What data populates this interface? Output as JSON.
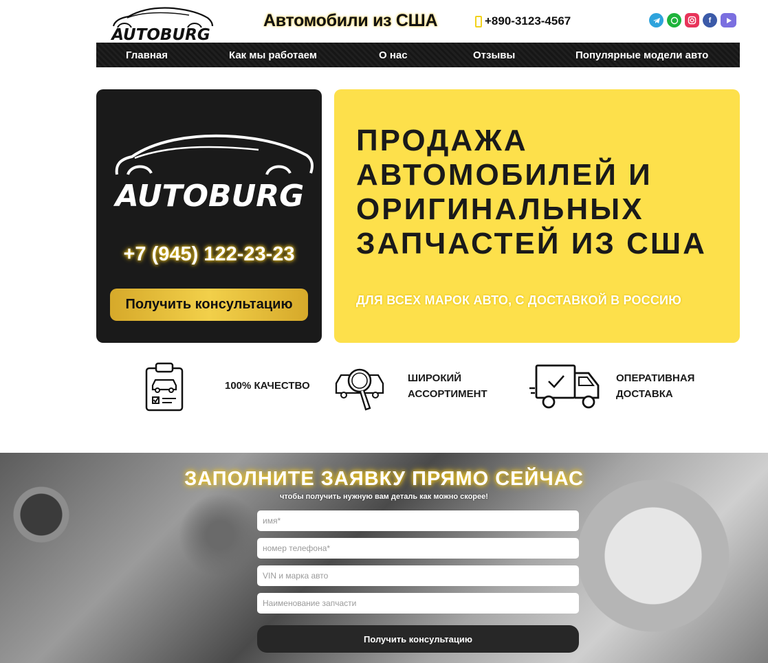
{
  "header": {
    "logo_text": "AUTOBURG",
    "tagline": "Автомобили из США",
    "phone": "+890-3123-4567",
    "socials": [
      "telegram-icon",
      "whatsapp-icon",
      "instagram-icon",
      "facebook-icon",
      "youtube-icon"
    ]
  },
  "nav": {
    "items": [
      "Главная",
      "Как мы работаем",
      "О нас",
      "Отзывы",
      "Популярные модели авто"
    ]
  },
  "hero": {
    "logo_text": "AUTOBURG",
    "phone": "+7 (945) 122-23-23",
    "consult_button": "Получить консультацию",
    "title_lines": [
      "ПРОДАЖА",
      "АВТОМОБИЛЕЙ И",
      "ОРИГИНАЛЬНЫХ",
      "ЗАПЧАСТЕЙ ИЗ США"
    ],
    "subtitle": "ДЛЯ ВСЕХ МАРОК АВТО, С ДОСТАВКОЙ В РОССИЮ"
  },
  "features": [
    {
      "icon": "clipboard-car-icon",
      "lines": [
        "100% КАЧЕСТВО"
      ]
    },
    {
      "icon": "magnifier-car-icon",
      "lines": [
        "ШИРОКИЙ",
        "АССОРТИМЕНТ"
      ]
    },
    {
      "icon": "delivery-truck-icon",
      "lines": [
        "ОПЕРАТИВНАЯ",
        "ДОСТАВКА"
      ]
    }
  ],
  "form": {
    "title": "ЗАПОЛНИТЕ ЗАЯВКУ ПРЯМО СЕЙЧАС",
    "subtitle": "чтобы получить нужную вам деталь как можно скорее!",
    "fields": {
      "name": "имя*",
      "phone": "номер телефона*",
      "vin": "VIN и марка авто",
      "part": "Наименование запчасти"
    },
    "submit": "Получить консультацию"
  },
  "colors": {
    "accent_yellow": "#fde04b",
    "dark": "#1a1a1a",
    "gold_button": "#e0b830"
  }
}
